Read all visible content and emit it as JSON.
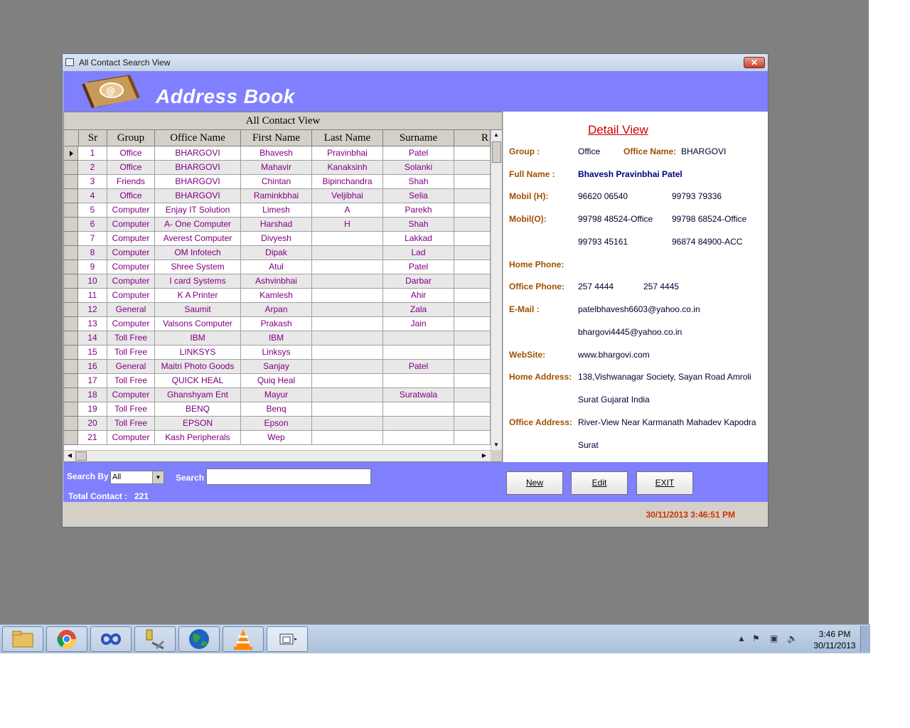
{
  "window": {
    "title": "All Contact Search View",
    "close": "✕"
  },
  "header": {
    "title": "Address Book"
  },
  "grid": {
    "caption": "All Contact View",
    "columns": [
      "Sr",
      "Group",
      "Office Name",
      "First Name",
      "Last Name",
      "Surname",
      "R"
    ],
    "rows": [
      [
        "1",
        "Office",
        "BHARGOVI",
        "Bhavesh",
        "Pravinbhai",
        "Patel"
      ],
      [
        "2",
        "Office",
        "BHARGOVI",
        "Mahavir",
        "Kanaksinh",
        "Solanki"
      ],
      [
        "3",
        "Friends",
        "BHARGOVI",
        "Chintan",
        "Bipinchandra",
        "Shah"
      ],
      [
        "4",
        "Office",
        "BHARGOVI",
        "Raminkbhai",
        "Veljibhai",
        "Selia"
      ],
      [
        "5",
        "Computer",
        "Enjay IT Solution",
        "Limesh",
        "A",
        "Parekh"
      ],
      [
        "6",
        "Computer",
        "A- One Computer",
        "Harshad",
        "H",
        "Shah"
      ],
      [
        "7",
        "Computer",
        "Averest Computer",
        "Divyesh",
        "",
        "Lakkad"
      ],
      [
        "8",
        "Computer",
        "OM Infotech",
        "Dipak",
        "",
        "Lad"
      ],
      [
        "9",
        "Computer",
        "Shree System",
        "Atul",
        "",
        "Patel"
      ],
      [
        "10",
        "Computer",
        "I card Systems",
        "Ashvinbhai",
        "",
        "Darbar"
      ],
      [
        "11",
        "Computer",
        "K A Printer",
        "Kamlesh",
        "",
        "Ahir"
      ],
      [
        "12",
        "General",
        "Saumit",
        "Arpan",
        "",
        "Zala"
      ],
      [
        "13",
        "Computer",
        "Valsons Computer",
        "Prakash",
        "",
        "Jain"
      ],
      [
        "14",
        "Toll Free",
        "IBM",
        "IBM",
        "",
        ""
      ],
      [
        "15",
        "Toll Free",
        "LINKSYS",
        "Linksys",
        "",
        ""
      ],
      [
        "16",
        "General",
        "Maitri Photo Goods",
        "Sanjay",
        "",
        "Patel"
      ],
      [
        "17",
        "Toll Free",
        "QUICK HEAL",
        "Quiq Heal",
        "",
        ""
      ],
      [
        "18",
        "Computer",
        "Ghanshyam Ent",
        "Mayur",
        "",
        "Suratwala"
      ],
      [
        "19",
        "Toll Free",
        "BENQ",
        "Benq",
        "",
        ""
      ],
      [
        "20",
        "Toll Free",
        "EPSON",
        "Epson",
        "",
        ""
      ],
      [
        "21",
        "Computer",
        "Kash Peripherals",
        "Wep",
        "",
        ""
      ]
    ]
  },
  "detail": {
    "title": "Detail View",
    "group_label": "Group :",
    "group": "Office",
    "office_name_label": "Office Name:",
    "office_name": "BHARGOVI",
    "full_name_label": "Full Name :",
    "full_name": "Bhavesh Pravinbhai Patel",
    "mobil_h_label": "Mobil (H):",
    "mobil_h1": "96620 06540",
    "mobil_h2": "99793 79336",
    "mobil_o_label": "Mobil(O):",
    "mobil_o1": "99798 48524-Office",
    "mobil_o2": "99798 68524-Office",
    "mobil_o3": "99793 45161",
    "mobil_o4": "96874 84900-ACC",
    "home_phone_label": "Home Phone:",
    "office_phone_label": "Office Phone:",
    "office_phone1": "257 4444",
    "office_phone2": "257 4445",
    "email_label": "E-Mail :",
    "email1": "patelbhavesh6603@yahoo.co.in",
    "email2": "bhargovi4445@yahoo.co.in",
    "website_label": "WebSite:",
    "website": "www.bhargovi.com",
    "home_address_label": "Home Address:",
    "home_address1": "138,Vishwanagar Society, Sayan Road Amroli",
    "home_address2": "Surat  Gujarat  India",
    "office_address_label": "Office Address:",
    "office_address1": "River-View Near Karmanath Mahadev Kapodra",
    "office_address2": "Surat"
  },
  "search": {
    "search_by_label": "Search By",
    "search_by_value": "All",
    "search_label": "Search",
    "total_label": "Total Contact :",
    "total_value": "221"
  },
  "buttons": {
    "new": "New",
    "edit": "Edit",
    "exit": "EXIT"
  },
  "status": {
    "datetime": "30/11/2013 3:46:51 PM"
  },
  "taskbar": {
    "time": "3:46 PM",
    "date": "30/11/2013"
  }
}
